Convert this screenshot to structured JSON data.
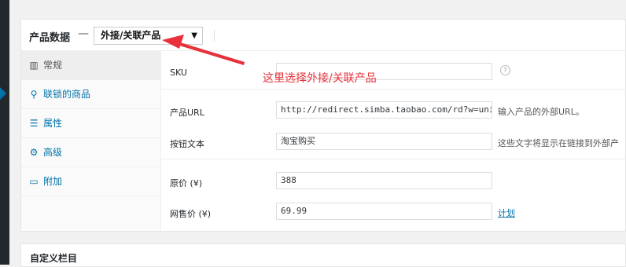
{
  "panel": {
    "title": "产品数据",
    "dash": "—",
    "product_type": "外接/关联产品",
    "caret": "▼"
  },
  "tabs": [
    {
      "label": "常规",
      "icon": "general-icon",
      "glyph": "▥",
      "active": true
    },
    {
      "label": "联锁的商品",
      "icon": "link-icon",
      "glyph": "⚲",
      "active": false
    },
    {
      "label": "属性",
      "icon": "attributes-icon",
      "glyph": "☰",
      "active": false
    },
    {
      "label": "高级",
      "icon": "gear-icon",
      "glyph": "⚙",
      "active": false
    },
    {
      "label": "附加",
      "icon": "addon-icon",
      "glyph": "▭",
      "active": false
    }
  ],
  "fields": {
    "sku": {
      "label": "SKU",
      "value": "",
      "help": "?"
    },
    "product_url": {
      "label": "产品URL",
      "value": "http://redirect.simba.taobao.com/rd?w=unio",
      "hint": "输入产品的外部URL。"
    },
    "button_text": {
      "label": "按钮文本",
      "value": "淘宝购买",
      "hint": "这些文字将显示在链接到外部产"
    },
    "regular_price": {
      "label": "原价 (¥)",
      "value": "388"
    },
    "sale_price": {
      "label": "网售价 (¥)",
      "value": "69.99",
      "schedule": "计划"
    }
  },
  "annotation": {
    "text": "这里选择外接/关联产品",
    "color": "#e8313b"
  },
  "bottom_panel": {
    "title": "自定义栏目"
  }
}
